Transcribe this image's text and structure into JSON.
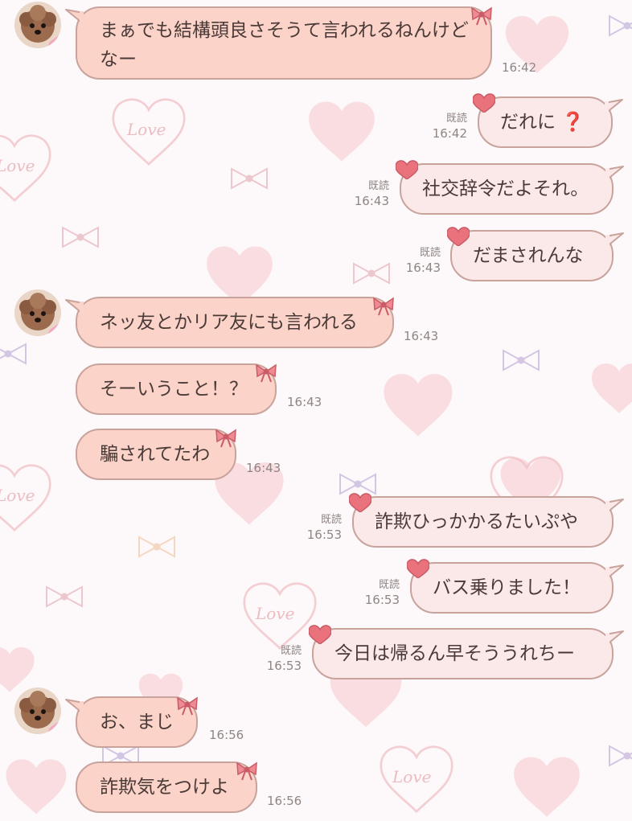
{
  "colors": {
    "incoming_bubble": "#fbd3c8",
    "outgoing_bubble": "#fbe9ea",
    "bubble_border": "#c8a39c",
    "text": "#4a3a37",
    "meta_text": "#8f8684",
    "question_mark": "#d61f26"
  },
  "background_theme": {
    "decoration": "hearts-and-ribbons",
    "watermark_words": [
      "Love",
      "Love",
      "Love",
      "Love",
      "Love"
    ]
  },
  "messages": [
    {
      "direction": "incoming",
      "text": "まぁでも結構頭良さそうて言われるねんけどなー",
      "time": "16:42",
      "avatar": "poodle-avatar"
    },
    {
      "direction": "outgoing",
      "text": "だれに",
      "emoji": "❓",
      "read": "既読",
      "time": "16:42"
    },
    {
      "direction": "outgoing",
      "text": "社交辞令だよそれ。",
      "read": "既読",
      "time": "16:43"
    },
    {
      "direction": "outgoing",
      "text": "だまされんな",
      "read": "既読",
      "time": "16:43"
    },
    {
      "direction": "incoming",
      "text": "ネッ友とかリア友にも言われる",
      "time": "16:43",
      "avatar": "poodle-avatar"
    },
    {
      "direction": "incoming",
      "text": "そーいうこと！？",
      "time": "16:43"
    },
    {
      "direction": "incoming",
      "text": "騙されてたわ",
      "time": "16:43"
    },
    {
      "direction": "outgoing",
      "text": "詐欺ひっかかるたいぷや",
      "read": "既読",
      "time": "16:53"
    },
    {
      "direction": "outgoing",
      "text": "バス乗りました！",
      "read": "既読",
      "time": "16:53"
    },
    {
      "direction": "outgoing",
      "text": "今日は帰るん早そううれちー",
      "read": "既読",
      "time": "16:53"
    },
    {
      "direction": "incoming",
      "text": "お、まじ",
      "time": "16:56",
      "avatar": "poodle-avatar"
    },
    {
      "direction": "incoming",
      "text": "詐欺気をつけよ",
      "time": "16:56"
    }
  ]
}
